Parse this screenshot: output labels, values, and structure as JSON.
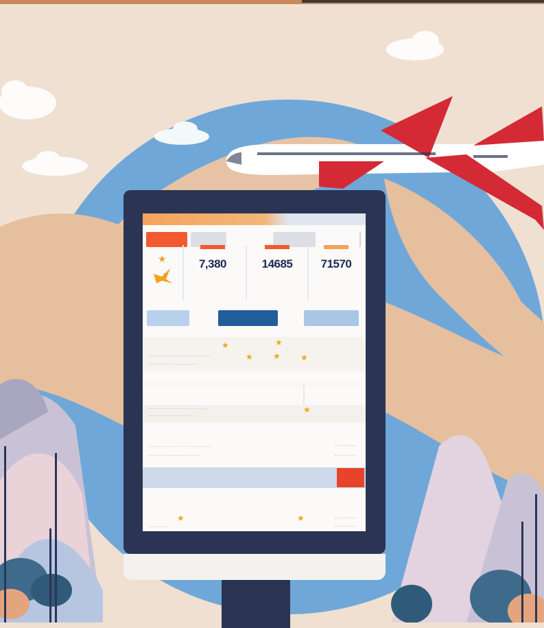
{
  "kiosk": {
    "topbar_title": "",
    "filters": {
      "primary": "",
      "option_1": "",
      "option_2": "",
      "option_3": "",
      "option_4": ""
    },
    "fares": [
      {
        "price": "7,380",
        "sub": ""
      },
      {
        "price": "14685",
        "sub": ""
      },
      {
        "price": "71570",
        "sub": ""
      }
    ],
    "fare_codes": {
      "left": "",
      "middle": "",
      "right": ""
    },
    "buttons": {
      "left": "",
      "center": "",
      "right": ""
    },
    "rows": [
      {
        "title": "",
        "right": ""
      },
      {
        "title": "",
        "right": ""
      },
      {
        "title": "",
        "right": ""
      },
      {
        "title": "",
        "right": ""
      }
    ],
    "banner": {
      "label": "",
      "button": ""
    }
  },
  "colors": {
    "accent": "#f05a2e",
    "navy": "#2b3553",
    "sky": "#8fb8de",
    "background": "#f0e0d2"
  }
}
